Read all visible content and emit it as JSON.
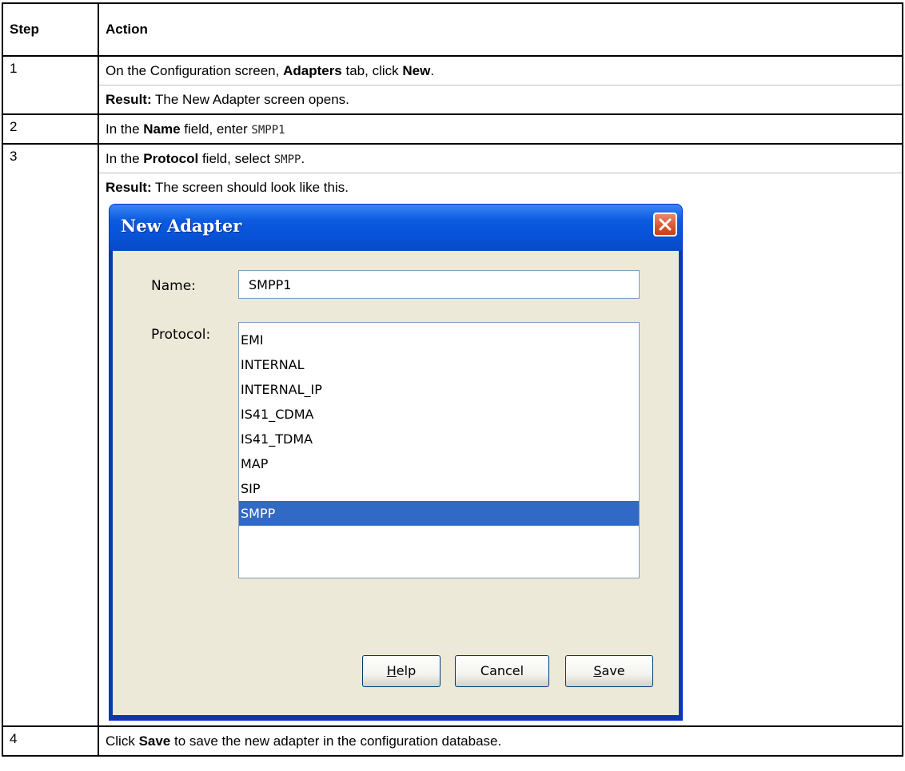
{
  "table": {
    "headers": {
      "step": "Step",
      "action": "Action"
    },
    "rows": [
      {
        "step": "1",
        "lines": [
          {
            "pre": "On the Configuration screen, ",
            "b1": "Adapters",
            "mid": " tab, click ",
            "b2": "New",
            "post": "."
          },
          {
            "b": "Result:",
            "post": " The New Adapter screen opens."
          }
        ]
      },
      {
        "step": "2",
        "pre": "In the ",
        "b": "Name",
        "mid": " field, enter ",
        "code": "SMPP1"
      },
      {
        "step": "3",
        "pre": "In the ",
        "b": "Protocol",
        "mid": " field, select ",
        "code": "SMPP",
        "post": ".",
        "result_b": "Result:",
        "result_post": " The screen should look like this."
      },
      {
        "step": "4",
        "pre": "Click ",
        "b": "Save",
        "post": " to save the new adapter in the configuration database."
      }
    ]
  },
  "dialog": {
    "title": "New Adapter",
    "close_icon": "close-icon",
    "name_label": "Name:",
    "name_value": "SMPP1",
    "protocol_label": "Protocol:",
    "protocol_options": [
      "EMI",
      "INTERNAL",
      "INTERNAL_IP",
      "IS41_CDMA",
      "IS41_TDMA",
      "MAP",
      "SIP",
      "SMPP"
    ],
    "selected_protocol": "SMPP",
    "buttons": {
      "help": {
        "mnemonic": "H",
        "rest": "elp"
      },
      "cancel": "Cancel",
      "save": {
        "mnemonic": "S",
        "rest": "ave"
      }
    },
    "colors": {
      "titlebar": "#0a5ae0",
      "selection": "#316ac5",
      "client": "#ece9d8",
      "close": "#d8542c"
    }
  }
}
